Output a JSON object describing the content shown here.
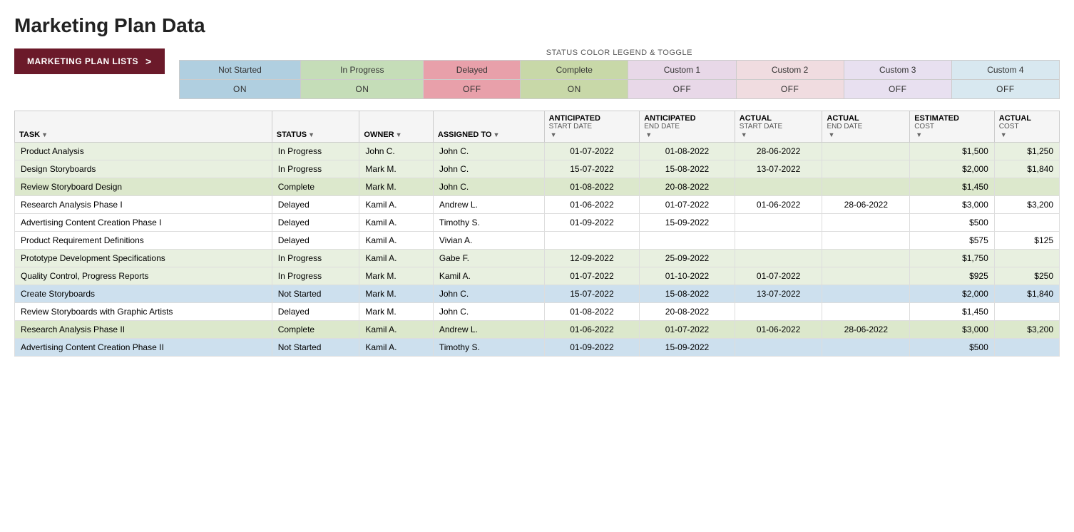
{
  "title": "Marketing Plan Data",
  "sidebar_button": {
    "label": "MARKETING PLAN LISTS",
    "arrow": ">"
  },
  "legend": {
    "title": "STATUS COLOR LEGEND & TOGGLE",
    "statuses": [
      {
        "name": "Not Started",
        "toggle": "ON",
        "class": "status-not-started"
      },
      {
        "name": "In Progress",
        "toggle": "ON",
        "class": "status-in-progress"
      },
      {
        "name": "Delayed",
        "toggle": "OFF",
        "class": "status-delayed"
      },
      {
        "name": "Complete",
        "toggle": "ON",
        "class": "status-complete"
      },
      {
        "name": "Custom 1",
        "toggle": "OFF",
        "class": "status-custom1"
      },
      {
        "name": "Custom 2",
        "toggle": "OFF",
        "class": "status-custom2"
      },
      {
        "name": "Custom 3",
        "toggle": "OFF",
        "class": "status-custom3"
      },
      {
        "name": "Custom 4",
        "toggle": "OFF",
        "class": "status-custom4"
      }
    ]
  },
  "table": {
    "headers": [
      {
        "id": "task",
        "label": "TASK",
        "sub": ""
      },
      {
        "id": "status",
        "label": "STATUS",
        "sub": ""
      },
      {
        "id": "owner",
        "label": "OWNER",
        "sub": ""
      },
      {
        "id": "assigned_to",
        "label": "ASSIGNED TO",
        "sub": ""
      },
      {
        "id": "ant_start",
        "label": "ANTICIPATED",
        "sub": "START DATE"
      },
      {
        "id": "ant_end",
        "label": "ANTICIPATED",
        "sub": "END DATE"
      },
      {
        "id": "act_start",
        "label": "ACTUAL",
        "sub": "START DATE"
      },
      {
        "id": "act_end",
        "label": "ACTUAL",
        "sub": "END DATE"
      },
      {
        "id": "est_cost",
        "label": "ESTIMATED",
        "sub": "COST"
      },
      {
        "id": "act_cost",
        "label": "ACTUAL",
        "sub": "COST"
      }
    ],
    "rows": [
      {
        "task": "Product Analysis",
        "status": "In Progress",
        "owner": "John C.",
        "assigned_to": "John C.",
        "ant_start": "01-07-2022",
        "ant_end": "01-08-2022",
        "act_start": "28-06-2022",
        "act_end": "",
        "est_cost": "$1,500",
        "act_cost": "$1,250",
        "row_class": "row-in-progress"
      },
      {
        "task": "Design Storyboards",
        "status": "In Progress",
        "owner": "Mark M.",
        "assigned_to": "John C.",
        "ant_start": "15-07-2022",
        "ant_end": "15-08-2022",
        "act_start": "13-07-2022",
        "act_end": "",
        "est_cost": "$2,000",
        "act_cost": "$1,840",
        "row_class": "row-in-progress"
      },
      {
        "task": "Review Storyboard Design",
        "status": "Complete",
        "owner": "Mark M.",
        "assigned_to": "John C.",
        "ant_start": "01-08-2022",
        "ant_end": "20-08-2022",
        "act_start": "",
        "act_end": "",
        "est_cost": "$1,450",
        "act_cost": "",
        "row_class": "row-complete"
      },
      {
        "task": "Research Analysis Phase I",
        "status": "Delayed",
        "owner": "Kamil A.",
        "assigned_to": "Andrew L.",
        "ant_start": "01-06-2022",
        "ant_end": "01-07-2022",
        "act_start": "01-06-2022",
        "act_end": "28-06-2022",
        "est_cost": "$3,000",
        "act_cost": "$3,200",
        "row_class": "row-delayed"
      },
      {
        "task": "Advertising Content Creation Phase I",
        "status": "Delayed",
        "owner": "Kamil A.",
        "assigned_to": "Timothy S.",
        "ant_start": "01-09-2022",
        "ant_end": "15-09-2022",
        "act_start": "",
        "act_end": "",
        "est_cost": "$500",
        "act_cost": "",
        "row_class": "row-delayed"
      },
      {
        "task": "Product Requirement Definitions",
        "status": "Delayed",
        "owner": "Kamil A.",
        "assigned_to": "Vivian A.",
        "ant_start": "",
        "ant_end": "",
        "act_start": "",
        "act_end": "",
        "est_cost": "$575",
        "act_cost": "$125",
        "row_class": "row-delayed"
      },
      {
        "task": "Prototype Development Specifications",
        "status": "In Progress",
        "owner": "Kamil A.",
        "assigned_to": "Gabe F.",
        "ant_start": "12-09-2022",
        "ant_end": "25-09-2022",
        "act_start": "",
        "act_end": "",
        "est_cost": "$1,750",
        "act_cost": "",
        "row_class": "row-in-progress"
      },
      {
        "task": "Quality Control, Progress Reports",
        "status": "In Progress",
        "owner": "Mark M.",
        "assigned_to": "Kamil A.",
        "ant_start": "01-07-2022",
        "ant_end": "01-10-2022",
        "act_start": "01-07-2022",
        "act_end": "",
        "est_cost": "$925",
        "act_cost": "$250",
        "row_class": "row-in-progress"
      },
      {
        "task": "Create Storyboards",
        "status": "Not Started",
        "owner": "Mark M.",
        "assigned_to": "John C.",
        "ant_start": "15-07-2022",
        "ant_end": "15-08-2022",
        "act_start": "13-07-2022",
        "act_end": "",
        "est_cost": "$2,000",
        "act_cost": "$1,840",
        "row_class": "row-not-started"
      },
      {
        "task": "Review Storyboards with Graphic Artists",
        "status": "Delayed",
        "owner": "Mark M.",
        "assigned_to": "John C.",
        "ant_start": "01-08-2022",
        "ant_end": "20-08-2022",
        "act_start": "",
        "act_end": "",
        "est_cost": "$1,450",
        "act_cost": "",
        "row_class": "row-delayed"
      },
      {
        "task": "Research Analysis Phase II",
        "status": "Complete",
        "owner": "Kamil A.",
        "assigned_to": "Andrew L.",
        "ant_start": "01-06-2022",
        "ant_end": "01-07-2022",
        "act_start": "01-06-2022",
        "act_end": "28-06-2022",
        "est_cost": "$3,000",
        "act_cost": "$3,200",
        "row_class": "row-complete"
      },
      {
        "task": "Advertising Content Creation Phase II",
        "status": "Not Started",
        "owner": "Kamil A.",
        "assigned_to": "Timothy S.",
        "ant_start": "01-09-2022",
        "ant_end": "15-09-2022",
        "act_start": "",
        "act_end": "",
        "est_cost": "$500",
        "act_cost": "",
        "row_class": "row-not-started"
      }
    ]
  }
}
